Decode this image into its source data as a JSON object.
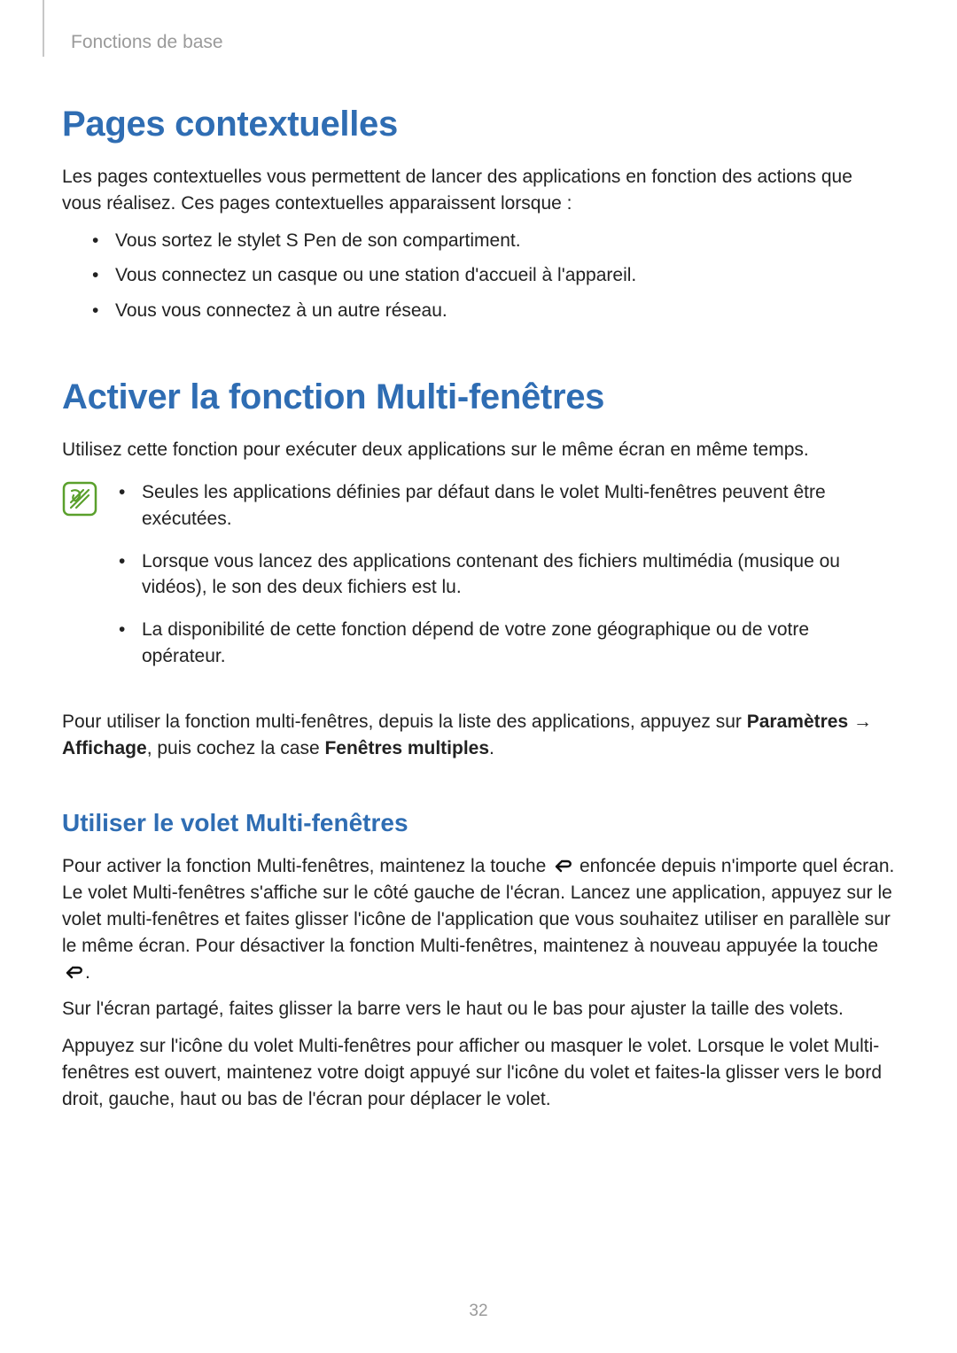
{
  "runningHead": "Fonctions de base",
  "pageNumber": "32",
  "section1": {
    "title": "Pages contextuelles",
    "intro": "Les pages contextuelles vous permettent de lancer des applications en fonction des actions que vous réalisez. Ces pages contextuelles apparaissent lorsque :",
    "bullets": [
      "Vous sortez le stylet S Pen de son compartiment.",
      "Vous connectez un casque ou une station d'accueil à l'appareil.",
      "Vous vous connectez à un autre réseau."
    ]
  },
  "section2": {
    "title": "Activer la fonction Multi-fenêtres",
    "intro": "Utilisez cette fonction pour exécuter deux applications sur le même écran en même temps.",
    "noteBullets": [
      "Seules les applications définies par défaut dans le volet Multi-fenêtres peuvent être exécutées.",
      "Lorsque vous lancez des applications contenant des fichiers multimédia (musique ou vidéos), le son des deux fichiers est lu.",
      "La disponibilité de cette fonction dépend de votre zone géographique ou de votre opérateur."
    ],
    "afterNote": {
      "pre": "Pour utiliser la fonction multi-fenêtres, depuis la liste des applications, appuyez sur ",
      "bold1": "Paramètres",
      "arrow": " → ",
      "bold2": "Affichage",
      "mid": ", puis cochez la case ",
      "bold3": "Fenêtres multiples",
      "post": "."
    },
    "sub": {
      "title": "Utiliser le volet Multi-fenêtres",
      "p1a": "Pour activer la fonction Multi-fenêtres, maintenez la touche ",
      "p1b": " enfoncée depuis n'importe quel écran. Le volet Multi-fenêtres s'affiche sur le côté gauche de l'écran. Lancez une application, appuyez sur le volet multi-fenêtres et faites glisser l'icône de l'application que vous souhaitez utiliser en parallèle sur le même écran. Pour désactiver la fonction Multi-fenêtres, maintenez à nouveau appuyée la touche ",
      "p1c": ".",
      "p2": "Sur l'écran partagé, faites glisser la barre vers le haut ou le bas pour ajuster la taille des volets.",
      "p3": "Appuyez sur l'icône du volet Multi-fenêtres pour afficher ou masquer le volet. Lorsque le volet Multi-fenêtres est ouvert, maintenez votre doigt appuyé sur l'icône du volet et faites-la glisser vers le bord droit, gauche, haut ou bas de l'écran pour déplacer le volet."
    }
  }
}
